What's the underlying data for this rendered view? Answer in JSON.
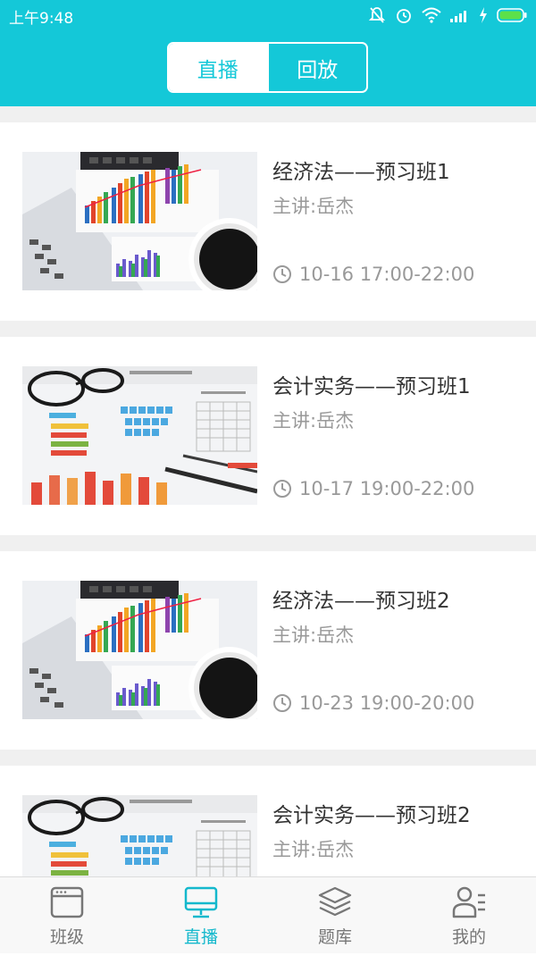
{
  "status_bar": {
    "time": "上午9:48"
  },
  "segmented": {
    "tabs": [
      {
        "label": "直播",
        "active": true
      },
      {
        "label": "回放",
        "active": false
      }
    ]
  },
  "courses": [
    {
      "title": "经济法——预习班1",
      "teacher": "主讲:岳杰",
      "time": "10-16 17:00-22:00",
      "thumb": "finance-charts-calculator"
    },
    {
      "title": "会计实务——预习班1",
      "teacher": "主讲:岳杰",
      "time": "10-17 19:00-22:00",
      "thumb": "documents-glasses-pen"
    },
    {
      "title": "经济法——预习班2",
      "teacher": "主讲:岳杰",
      "time": "10-23 19:00-20:00",
      "thumb": "finance-charts-calculator"
    },
    {
      "title": "会计实务——预习班2",
      "teacher": "主讲:岳杰",
      "time": "",
      "thumb": "documents-glasses-pen"
    }
  ],
  "bottom_nav": [
    {
      "label": "班级",
      "icon": "class-window-icon",
      "active": false
    },
    {
      "label": "直播",
      "icon": "monitor-icon",
      "active": true
    },
    {
      "label": "题库",
      "icon": "layers-icon",
      "active": false
    },
    {
      "label": "我的",
      "icon": "profile-icon",
      "active": false
    }
  ],
  "colors": {
    "accent": "#14c8d8",
    "nav_active": "#14b8cc",
    "text_primary": "#333333",
    "text_secondary": "#999999"
  }
}
